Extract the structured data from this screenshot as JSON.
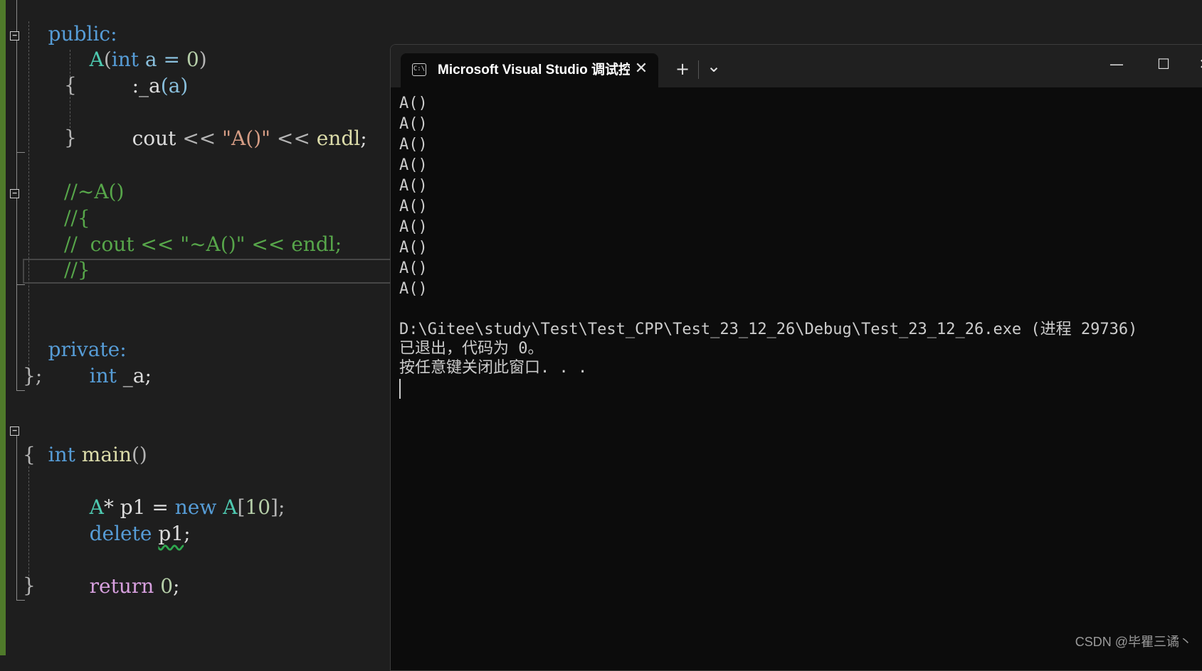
{
  "editor": {
    "lines": {
      "l_public": "public:",
      "l_ctor": [
        "A",
        "(",
        "int",
        " a = ",
        "0",
        ")"
      ],
      "l_init": [
        ":_a",
        "(a)"
      ],
      "l_open1": "{",
      "l_cout": [
        "cout",
        " << ",
        "\"A()\"",
        " << ",
        "endl",
        ";"
      ],
      "l_close1": "}",
      "l_cm1": "//~A()",
      "l_cm2": "//{",
      "l_cm3": "//  cout << \"~A()\" << endl;",
      "l_cm4": "//}",
      "l_private": "private:",
      "l_member": [
        "int",
        " _a;"
      ],
      "l_classend": "};",
      "l_main": [
        "int",
        " ",
        "main",
        "()"
      ],
      "l_open2": "{",
      "l_new": [
        "A",
        "* p1 = ",
        "new",
        " ",
        "A",
        "[",
        "10",
        "];"
      ],
      "l_delete": [
        "delete",
        " ",
        "p1",
        ";"
      ],
      "l_return": [
        "return",
        " ",
        "0",
        ";"
      ],
      "l_close2": "}"
    },
    "fold_glyph": "−"
  },
  "terminal": {
    "tab_title": "Microsoft Visual Studio 调试控制台",
    "tab_icon_text": "C:\\",
    "close_tab_glyph": "✕",
    "new_tab_glyph": "+",
    "dropdown_glyph": "⌄",
    "minimize_glyph": "—",
    "maximize_glyph": "☐",
    "close_glyph": "✕",
    "output": [
      "A()",
      "A()",
      "A()",
      "A()",
      "A()",
      "A()",
      "A()",
      "A()",
      "A()",
      "A()"
    ],
    "exit_path_line": "D:\\Gitee\\study\\Test\\Test_CPP\\Test_23_12_26\\Debug\\Test_23_12_26.exe (进程 29736)",
    "exit_code_line": "已退出，代码为 0。",
    "press_key_line": "按任意键关闭此窗口. . ."
  },
  "watermark": "CSDN @毕瞿三谲丶",
  "colors": {
    "keyword": "#569cd6",
    "control": "#d8a0df",
    "type": "#4ec9b0",
    "function": "#dcdcaa",
    "string": "#d69d85",
    "number": "#b5cea8",
    "comment": "#57a64a"
  }
}
